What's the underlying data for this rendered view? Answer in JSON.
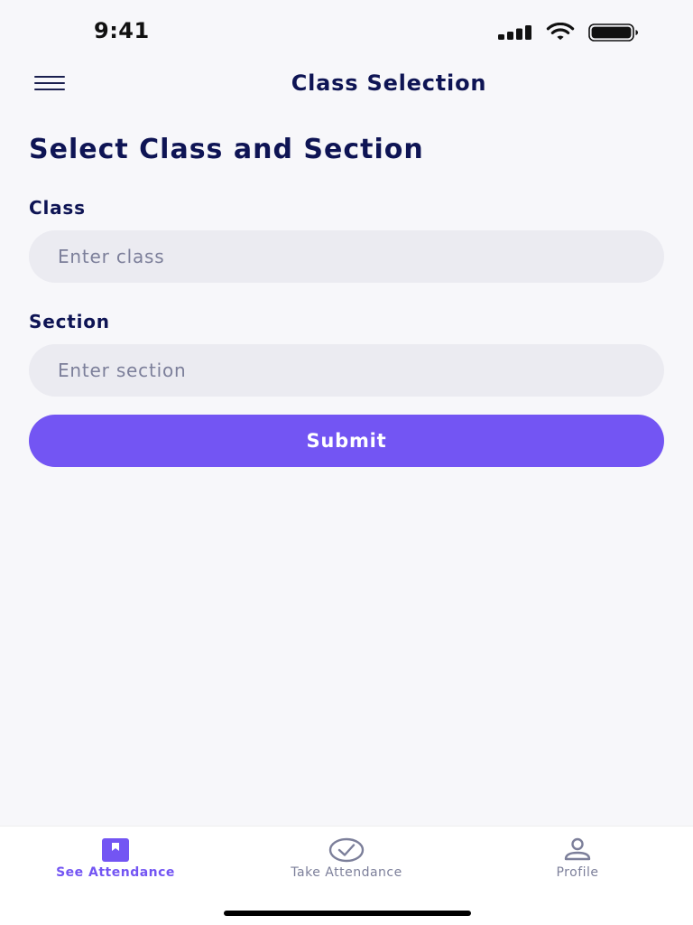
{
  "status_bar": {
    "time": "9:41",
    "signal_icon": "cellular-signal-icon",
    "wifi_icon": "wifi-icon",
    "battery_icon": "battery-icon"
  },
  "header": {
    "menu_icon": "hamburger-menu-icon",
    "title": "Class Selection"
  },
  "main": {
    "heading": "Select Class and Section",
    "class_field": {
      "label": "Class",
      "placeholder": "Enter class",
      "value": ""
    },
    "section_field": {
      "label": "Section",
      "placeholder": "Enter section",
      "value": ""
    },
    "submit_label": "Submit"
  },
  "tab_bar": {
    "tabs": [
      {
        "label": "See Attendance",
        "icon": "bookmark-book-icon",
        "active": true
      },
      {
        "label": "Take Attendance",
        "icon": "check-circle-icon",
        "active": false
      },
      {
        "label": "Profile",
        "icon": "person-icon",
        "active": false
      }
    ]
  },
  "colors": {
    "accent": "#7355f3",
    "heading": "#0e1454",
    "background": "#f7f7fa",
    "field_background": "#ebebf1",
    "inactive_tab": "#7c7f9a"
  }
}
